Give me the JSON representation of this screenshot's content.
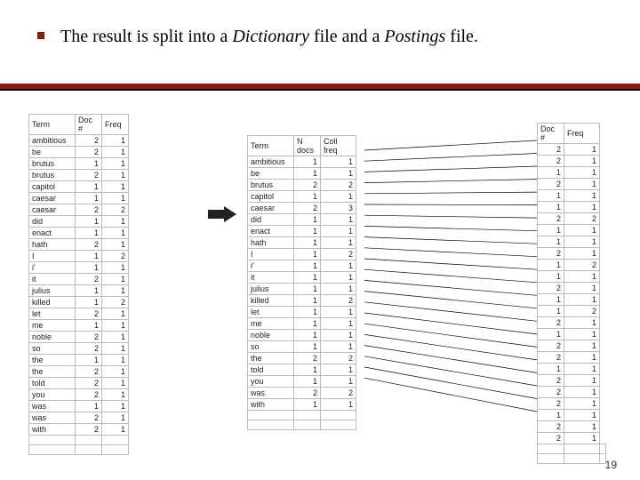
{
  "bullet_segments": [
    "The result is split into a ",
    "Dictionary",
    " file and a ",
    "Postings",
    " file."
  ],
  "page_number": "19",
  "left_table": {
    "headers": [
      "Term",
      "Doc #",
      "Freq"
    ],
    "rows": [
      [
        "ambitious",
        "2",
        "1"
      ],
      [
        "be",
        "2",
        "1"
      ],
      [
        "brutus",
        "1",
        "1"
      ],
      [
        "brutus",
        "2",
        "1"
      ],
      [
        "capitol",
        "1",
        "1"
      ],
      [
        "caesar",
        "1",
        "1"
      ],
      [
        "caesar",
        "2",
        "2"
      ],
      [
        "did",
        "1",
        "1"
      ],
      [
        "enact",
        "1",
        "1"
      ],
      [
        "hath",
        "2",
        "1"
      ],
      [
        "I",
        "1",
        "2"
      ],
      [
        "i'",
        "1",
        "1"
      ],
      [
        "it",
        "2",
        "1"
      ],
      [
        "julius",
        "1",
        "1"
      ],
      [
        "killed",
        "1",
        "2"
      ],
      [
        "let",
        "2",
        "1"
      ],
      [
        "me",
        "1",
        "1"
      ],
      [
        "noble",
        "2",
        "1"
      ],
      [
        "so",
        "2",
        "1"
      ],
      [
        "the",
        "1",
        "1"
      ],
      [
        "the",
        "2",
        "1"
      ],
      [
        "told",
        "2",
        "1"
      ],
      [
        "you",
        "2",
        "1"
      ],
      [
        "was",
        "1",
        "1"
      ],
      [
        "was",
        "2",
        "1"
      ],
      [
        "with",
        "2",
        "1"
      ],
      [
        "",
        "",
        ""
      ],
      [
        "",
        "",
        ""
      ]
    ]
  },
  "mid_table": {
    "headers": [
      "Term",
      "N docs",
      "Coll freq"
    ],
    "rows": [
      [
        "ambitious",
        "1",
        "1"
      ],
      [
        "be",
        "1",
        "1"
      ],
      [
        "brutus",
        "2",
        "2"
      ],
      [
        "capitol",
        "1",
        "1"
      ],
      [
        "caesar",
        "2",
        "3"
      ],
      [
        "did",
        "1",
        "1"
      ],
      [
        "enact",
        "1",
        "1"
      ],
      [
        "hath",
        "1",
        "1"
      ],
      [
        "I",
        "1",
        "2"
      ],
      [
        "i'",
        "1",
        "1"
      ],
      [
        "it",
        "1",
        "1"
      ],
      [
        "julius",
        "1",
        "1"
      ],
      [
        "killed",
        "1",
        "2"
      ],
      [
        "let",
        "1",
        "1"
      ],
      [
        "me",
        "1",
        "1"
      ],
      [
        "noble",
        "1",
        "1"
      ],
      [
        "so",
        "1",
        "1"
      ],
      [
        "the",
        "2",
        "2"
      ],
      [
        "told",
        "1",
        "1"
      ],
      [
        "you",
        "1",
        "1"
      ],
      [
        "was",
        "2",
        "2"
      ],
      [
        "with",
        "1",
        "1"
      ],
      [
        "",
        "",
        ""
      ],
      [
        "",
        "",
        ""
      ]
    ]
  },
  "right_table": {
    "headers": [
      "Doc #",
      "Freq"
    ],
    "rows": [
      [
        "2",
        "1"
      ],
      [
        "2",
        "1"
      ],
      [
        "1",
        "1"
      ],
      [
        "2",
        "1"
      ],
      [
        "1",
        "1"
      ],
      [
        "1",
        "1"
      ],
      [
        "2",
        "2"
      ],
      [
        "1",
        "1"
      ],
      [
        "1",
        "1"
      ],
      [
        "2",
        "1"
      ],
      [
        "1",
        "2"
      ],
      [
        "1",
        "1"
      ],
      [
        "2",
        "1"
      ],
      [
        "1",
        "1"
      ],
      [
        "1",
        "2"
      ],
      [
        "2",
        "1"
      ],
      [
        "1",
        "1"
      ],
      [
        "2",
        "1"
      ],
      [
        "2",
        "1"
      ],
      [
        "1",
        "1"
      ],
      [
        "2",
        "1"
      ],
      [
        "2",
        "1"
      ],
      [
        "2",
        "1"
      ],
      [
        "1",
        "1"
      ],
      [
        "2",
        "1"
      ],
      [
        "2",
        "1"
      ],
      [
        "",
        "",
        ""
      ],
      [
        "",
        "",
        ""
      ]
    ]
  },
  "chart_data": {
    "type": "table",
    "title": "Dictionary and Postings files",
    "tables": [
      {
        "name": "term-doc-freq",
        "columns": [
          "Term",
          "Doc #",
          "Freq"
        ],
        "rows": [
          [
            "ambitious",
            2,
            1
          ],
          [
            "be",
            2,
            1
          ],
          [
            "brutus",
            1,
            1
          ],
          [
            "brutus",
            2,
            1
          ],
          [
            "capitol",
            1,
            1
          ],
          [
            "caesar",
            1,
            1
          ],
          [
            "caesar",
            2,
            2
          ],
          [
            "did",
            1,
            1
          ],
          [
            "enact",
            1,
            1
          ],
          [
            "hath",
            2,
            1
          ],
          [
            "I",
            1,
            2
          ],
          [
            "i'",
            1,
            1
          ],
          [
            "it",
            2,
            1
          ],
          [
            "julius",
            1,
            1
          ],
          [
            "killed",
            1,
            2
          ],
          [
            "let",
            2,
            1
          ],
          [
            "me",
            1,
            1
          ],
          [
            "noble",
            2,
            1
          ],
          [
            "so",
            2,
            1
          ],
          [
            "the",
            1,
            1
          ],
          [
            "the",
            2,
            1
          ],
          [
            "told",
            2,
            1
          ],
          [
            "you",
            2,
            1
          ],
          [
            "was",
            1,
            1
          ],
          [
            "was",
            2,
            1
          ],
          [
            "with",
            2,
            1
          ]
        ]
      },
      {
        "name": "dictionary",
        "columns": [
          "Term",
          "N docs",
          "Coll freq"
        ],
        "rows": [
          [
            "ambitious",
            1,
            1
          ],
          [
            "be",
            1,
            1
          ],
          [
            "brutus",
            2,
            2
          ],
          [
            "capitol",
            1,
            1
          ],
          [
            "caesar",
            2,
            3
          ],
          [
            "did",
            1,
            1
          ],
          [
            "enact",
            1,
            1
          ],
          [
            "hath",
            1,
            1
          ],
          [
            "I",
            1,
            2
          ],
          [
            "i'",
            1,
            1
          ],
          [
            "it",
            1,
            1
          ],
          [
            "julius",
            1,
            1
          ],
          [
            "killed",
            1,
            2
          ],
          [
            "let",
            1,
            1
          ],
          [
            "me",
            1,
            1
          ],
          [
            "noble",
            1,
            1
          ],
          [
            "so",
            1,
            1
          ],
          [
            "the",
            2,
            2
          ],
          [
            "told",
            1,
            1
          ],
          [
            "you",
            1,
            1
          ],
          [
            "was",
            2,
            2
          ],
          [
            "with",
            1,
            1
          ]
        ]
      },
      {
        "name": "postings",
        "columns": [
          "Doc #",
          "Freq"
        ],
        "rows": [
          [
            2,
            1
          ],
          [
            2,
            1
          ],
          [
            1,
            1
          ],
          [
            2,
            1
          ],
          [
            1,
            1
          ],
          [
            1,
            1
          ],
          [
            2,
            2
          ],
          [
            1,
            1
          ],
          [
            1,
            1
          ],
          [
            2,
            1
          ],
          [
            1,
            2
          ],
          [
            1,
            1
          ],
          [
            2,
            1
          ],
          [
            1,
            1
          ],
          [
            1,
            2
          ],
          [
            2,
            1
          ],
          [
            1,
            1
          ],
          [
            2,
            1
          ],
          [
            2,
            1
          ],
          [
            1,
            1
          ],
          [
            2,
            1
          ],
          [
            2,
            1
          ],
          [
            2,
            1
          ],
          [
            1,
            1
          ],
          [
            2,
            1
          ],
          [
            2,
            1
          ]
        ]
      }
    ]
  }
}
